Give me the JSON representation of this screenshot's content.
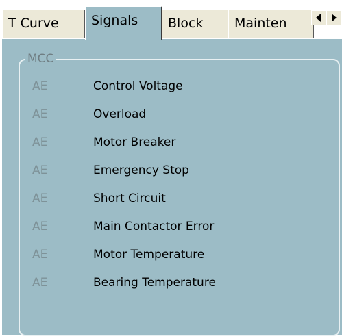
{
  "tabs": [
    {
      "label": "T Curve",
      "active": false
    },
    {
      "label": "Signals",
      "active": true
    },
    {
      "label": "Block",
      "active": false
    },
    {
      "label": "Mainten",
      "active": false
    }
  ],
  "tab_scroll": {
    "left_icon": "triangle-left-icon",
    "right_icon": "triangle-right-icon"
  },
  "group": {
    "title": "MCC",
    "signals": [
      {
        "state": "AE",
        "name": "Control Voltage"
      },
      {
        "state": "AE",
        "name": "Overload"
      },
      {
        "state": "AE",
        "name": "Motor Breaker"
      },
      {
        "state": "AE",
        "name": "Emergency Stop"
      },
      {
        "state": "AE",
        "name": "Short Circuit"
      },
      {
        "state": "AE",
        "name": "Main Contactor Error"
      },
      {
        "state": "AE",
        "name": "Motor Temperature"
      },
      {
        "state": "AE",
        "name": "Bearing Temperature"
      }
    ]
  },
  "colors": {
    "panel_bg": "#9cbcc6",
    "tab_bg": "#ece9d8",
    "state_text": "#7e9298",
    "group_border": "#e8f0f2"
  }
}
